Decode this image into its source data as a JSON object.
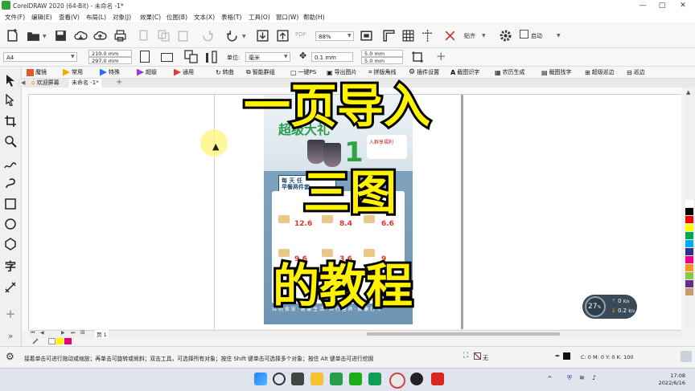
{
  "window": {
    "title": "CorelDRAW 2020 (64-Bit) - 未命名 -1*",
    "controls": [
      "—",
      "□",
      "✕"
    ]
  },
  "menu": [
    "文件(F)",
    "编辑(E)",
    "查看(V)",
    "布局(L)",
    "对象(J)",
    "效果(C)",
    "位图(B)",
    "文本(X)",
    "表格(T)",
    "工具(O)",
    "窗口(W)",
    "帮助(H)"
  ],
  "toolbar": {
    "pdf_label": "PDF",
    "zoom_value": "88%",
    "snap_label": "贴齐",
    "launch_label": "启动"
  },
  "property_bar": {
    "page_size": "A4",
    "width": "210.0 mm",
    "height": "297.0 mm",
    "units_label": "单位:",
    "units_value": "毫米",
    "nudge": "0.1 mm",
    "dup_x": "5.0 mm",
    "dup_y": "5.0 mm"
  },
  "plugins": [
    "魔镜",
    "常用",
    "特殊",
    "超级",
    "通用",
    "转曲",
    "智能群组",
    "一键PS",
    "导出图片",
    "拼版角线",
    "插件设置",
    "截图识字",
    "农历生成",
    "截图找字",
    "超级巡边",
    "巡边"
  ],
  "tabs": [
    "欢迎屏幕",
    "未命名 -1*"
  ],
  "canvas": {
    "overlay_lines": [
      "一页导入",
      "三图",
      "的教程"
    ],
    "poster": {
      "heading": "超级大礼",
      "big_number": "1",
      "badge_text": "入群享福利",
      "ribbon_text": "每 天 任\n早餐两件套",
      "prices": [
        "12.6",
        "8.4",
        "6.6",
        "9.6",
        "3.6",
        "9"
      ],
      "bottom_text": "共 创 食 安 · 健 康 生 活 · 共 行 营 养 · 健 康 打 卡"
    }
  },
  "page_nav": {
    "page_label": "页 1"
  },
  "status": {
    "hint": "接着单击可进行拖动或缩放；再单击可旋转或倾斜；双击工具，可选择所有对象；按住 Shift 键单击可选择多个对象；按住 Alt 键单击可进行挖掘",
    "fill_label": "无",
    "color_values": "C: 0 M: 0 Y: 0 K: 100"
  },
  "net_widget": {
    "percent": "27",
    "percent_unit": "%",
    "up": "0",
    "up_unit": "K/s",
    "down": "0.2",
    "down_unit": "K/s"
  },
  "taskbar": {
    "time": "17:08",
    "date": "2022/6/16"
  },
  "colors": {
    "overlay_text": "#fff200",
    "accent_green": "#2fa33a",
    "palette": [
      "#ffffff",
      "#000000",
      "#ff0000",
      "#ffff00",
      "#00a651",
      "#00aeef",
      "#2e3192",
      "#ec008c",
      "#f7941d",
      "#8dc63f",
      "#662d91",
      "#c69c6d"
    ]
  }
}
